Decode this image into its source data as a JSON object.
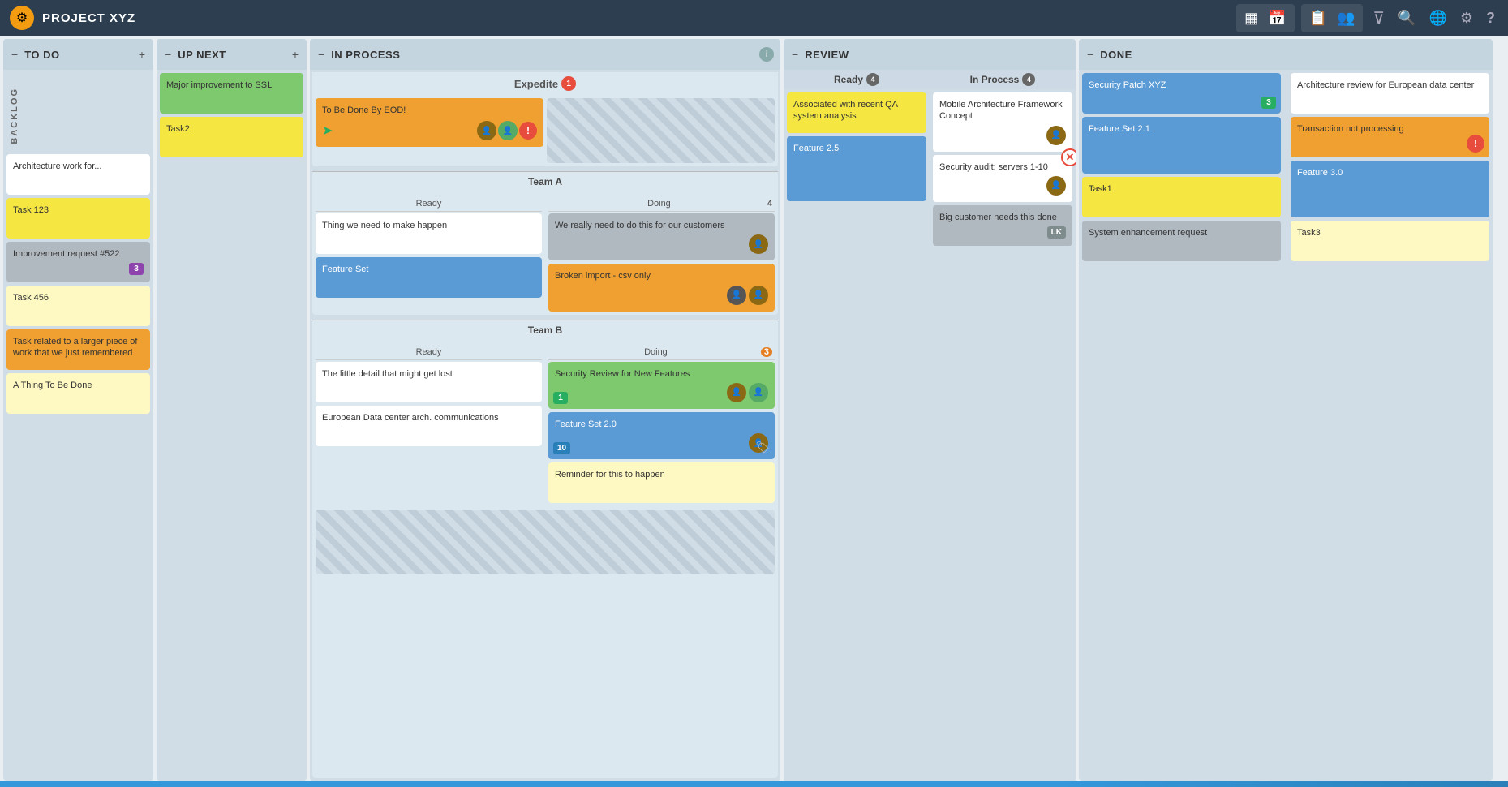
{
  "header": {
    "title": "PROJECT XYZ",
    "logo": "⚙",
    "icons": [
      "▦",
      "📅",
      "📋",
      "👥",
      "▼",
      "🔍",
      "🌐",
      "⚙",
      "?"
    ]
  },
  "columns": {
    "todo": {
      "label": "TO DO",
      "cards": [
        {
          "text": "Architecture work for...",
          "color": "white"
        },
        {
          "text": "Task 123",
          "color": "yellow"
        },
        {
          "text": "Improvement request #522",
          "color": "gray",
          "badge": "3"
        },
        {
          "text": "Task 456",
          "color": "lt-yellow"
        },
        {
          "text": "Task related to a larger piece of work that we just remembered",
          "color": "orange"
        },
        {
          "text": "A Thing To Be Done",
          "color": "lt-yellow"
        }
      ]
    },
    "upnext": {
      "label": "UP NEXT",
      "cards": [
        {
          "text": "Major improvement to SSL",
          "color": "green"
        },
        {
          "text": "Task2",
          "color": "yellow"
        }
      ]
    },
    "inprocess": {
      "label": "IN PROCESS",
      "expedite": {
        "label": "Expedite",
        "count": 1,
        "cards": [
          {
            "text": "To Be Done By EOD!",
            "color": "orange",
            "avatars": 2,
            "hasArrow": true,
            "hasAlert": true
          }
        ]
      },
      "teams": [
        {
          "name": "Team A",
          "ready_cards": [
            {
              "text": "Thing we need to make happen",
              "color": "white"
            },
            {
              "text": "Feature Set",
              "color": "blue"
            }
          ],
          "doing_count": 4,
          "doing_cards": [
            {
              "text": "We really need to do this for our customers",
              "color": "gray",
              "avatar": true
            },
            {
              "text": "Broken import - csv only",
              "color": "orange",
              "avatar": true
            }
          ]
        },
        {
          "name": "Team B",
          "ready_cards": [
            {
              "text": "The little detail that might get lost",
              "color": "white"
            },
            {
              "text": "European Data center arch. communications",
              "color": "white"
            }
          ],
          "doing_count": 3,
          "doing_cards": [
            {
              "text": "Security Review for New Features",
              "color": "green",
              "avatar": true,
              "badge": "1"
            },
            {
              "text": "Feature Set 2.0",
              "color": "blue",
              "avatar": true,
              "badge": "10"
            },
            {
              "text": "Reminder for this to happen",
              "color": "lt-yellow"
            }
          ]
        }
      ]
    },
    "review": {
      "label": "REVIEW",
      "ready": {
        "label": "Ready",
        "count": 4,
        "cards": [
          {
            "text": "Associated with recent QA system analysis",
            "color": "yellow"
          },
          {
            "text": "Feature 2.5",
            "color": "blue"
          }
        ]
      },
      "inprocess": {
        "label": "In Process",
        "count": 4,
        "cards": [
          {
            "text": "Mobile Architecture Framework Concept",
            "color": "white",
            "avatar": true
          },
          {
            "text": "Security audit: servers 1-10",
            "color": "white",
            "avatar": true,
            "hasX": true
          },
          {
            "text": "Big customer needs this done",
            "color": "gray",
            "badge": "LK"
          }
        ]
      }
    },
    "done": {
      "label": "DONE",
      "col1": [
        {
          "text": "Security Patch XYZ",
          "color": "blue",
          "badge": "3"
        },
        {
          "text": "Feature Set 2.1",
          "color": "blue"
        },
        {
          "text": "Task1",
          "color": "yellow"
        },
        {
          "text": "System enhancement request",
          "color": "gray"
        }
      ],
      "col2": [
        {
          "text": "Architecture review for European data center",
          "color": "white"
        },
        {
          "text": "Transaction not processing",
          "color": "orange",
          "hasAlert": true
        },
        {
          "text": "Feature 3.0",
          "color": "blue"
        },
        {
          "text": "Task3",
          "color": "lt-yellow"
        }
      ]
    }
  }
}
